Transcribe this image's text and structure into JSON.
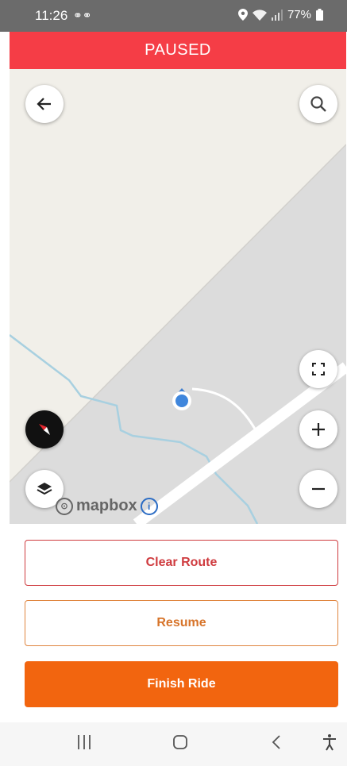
{
  "status": {
    "time": "11:26",
    "battery": "77%"
  },
  "banner": {
    "label": "PAUSED",
    "color": "#f53d46"
  },
  "map": {
    "attribution": "mapbox",
    "icons": {
      "back": "arrow-left-icon",
      "search": "search-icon",
      "fullscreen": "fullscreen-icon",
      "compass": "compass-icon",
      "zoom_in": "plus-icon",
      "zoom_out": "minus-icon",
      "layers": "layers-icon"
    }
  },
  "actions": {
    "clear_route": "Clear Route",
    "resume": "Resume",
    "finish": "Finish Ride"
  },
  "colors": {
    "clear": "#cf3b3f",
    "resume": "#d7742a",
    "finish": "#f2650f"
  }
}
